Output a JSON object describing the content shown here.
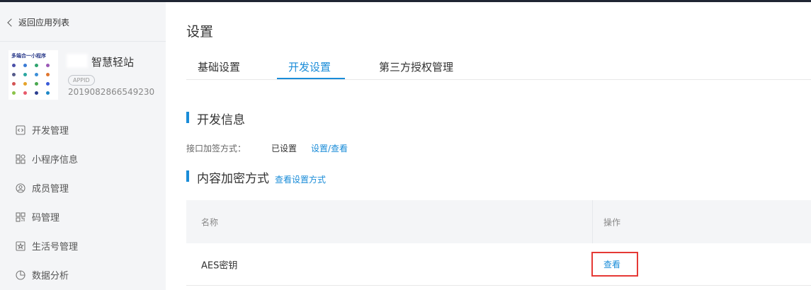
{
  "sidebar": {
    "back_label": "返回应用列表",
    "app_icon_title": "多端合一小程序",
    "app_name": "智慧轻站",
    "appid_badge": "APPID",
    "appid_value": "2019082866549230",
    "items": [
      {
        "label": "开发管理",
        "icon": "code-icon"
      },
      {
        "label": "小程序信息",
        "icon": "grid-icon"
      },
      {
        "label": "成员管理",
        "icon": "user-circle-icon"
      },
      {
        "label": "码管理",
        "icon": "qrcode-icon"
      },
      {
        "label": "生活号管理",
        "icon": "star-box-icon"
      },
      {
        "label": "数据分析",
        "icon": "pie-chart-icon"
      }
    ]
  },
  "main": {
    "title": "设置",
    "tabs": [
      {
        "label": "基础设置",
        "active": false
      },
      {
        "label": "开发设置",
        "active": true
      },
      {
        "label": "第三方授权管理",
        "active": false
      }
    ],
    "dev_info": {
      "title": "开发信息",
      "sign_label": "接口加签方式：",
      "sign_status": "已设置",
      "sign_link": "设置/查看"
    },
    "encryption": {
      "title": "内容加密方式",
      "help_link": "查看设置方式",
      "table": {
        "columns": [
          "名称",
          "操作"
        ],
        "rows": [
          {
            "name": "AES密钥",
            "action": "查看"
          }
        ]
      }
    }
  },
  "colors": {
    "accent": "#1a8cd8",
    "highlight_box": "#e53935",
    "sidebar_bg": "#f4f5f7"
  }
}
